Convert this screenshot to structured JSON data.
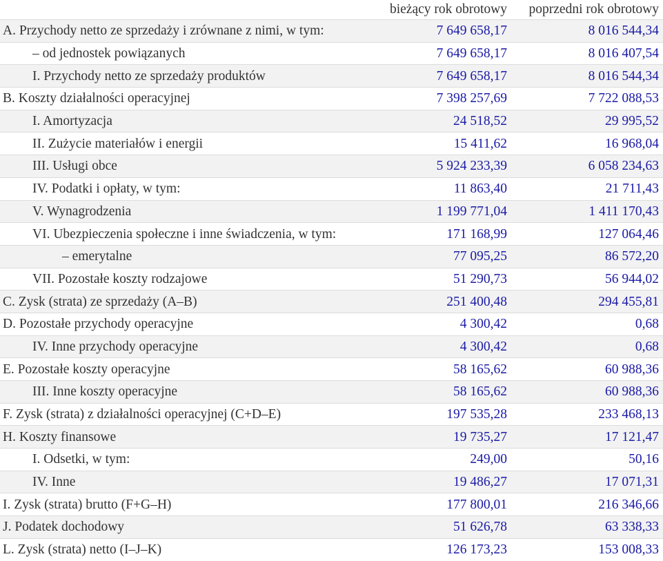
{
  "header": {
    "label": "",
    "current": "bieżący rok obrotowy",
    "previous": "poprzedni rok obrotowy"
  },
  "rows": [
    {
      "label": "A. Przychody netto ze sprzedaży i zrównane z nimi, w tym:",
      "current": "7 649 658,17",
      "previous": "8 016 544,34",
      "indent": 0
    },
    {
      "label": "– od jednostek powiązanych",
      "current": "7 649 658,17",
      "previous": "8 016 407,54",
      "indent": 1
    },
    {
      "label": "I. Przychody netto ze sprzedaży produktów",
      "current": "7 649 658,17",
      "previous": "8 016 544,34",
      "indent": 1
    },
    {
      "label": "B. Koszty działalności operacyjnej",
      "current": "7 398 257,69",
      "previous": "7 722 088,53",
      "indent": 0
    },
    {
      "label": "I. Amortyzacja",
      "current": "24 518,52",
      "previous": "29 995,52",
      "indent": 1
    },
    {
      "label": "II. Zużycie materiałów i energii",
      "current": "15 411,62",
      "previous": "16 968,04",
      "indent": 1
    },
    {
      "label": "III. Usługi obce",
      "current": "5 924 233,39",
      "previous": "6 058 234,63",
      "indent": 1
    },
    {
      "label": "IV. Podatki i opłaty, w tym:",
      "current": "11 863,40",
      "previous": "21 711,43",
      "indent": 1
    },
    {
      "label": "V. Wynagrodzenia",
      "current": "1 199 771,04",
      "previous": "1 411 170,43",
      "indent": 1
    },
    {
      "label": "VI. Ubezpieczenia społeczne i inne świadczenia, w tym:",
      "current": "171 168,99",
      "previous": "127 064,46",
      "indent": 1
    },
    {
      "label": "– emerytalne",
      "current": "77 095,25",
      "previous": "86 572,20",
      "indent": 2
    },
    {
      "label": "VII. Pozostałe koszty rodzajowe",
      "current": "51 290,73",
      "previous": "56 944,02",
      "indent": 1
    },
    {
      "label": "C. Zysk (strata) ze sprzedaży (A–B)",
      "current": "251 400,48",
      "previous": "294 455,81",
      "indent": 0
    },
    {
      "label": "D. Pozostałe przychody operacyjne",
      "current": "4 300,42",
      "previous": "0,68",
      "indent": 0
    },
    {
      "label": "IV. Inne przychody operacyjne",
      "current": "4 300,42",
      "previous": "0,68",
      "indent": 1
    },
    {
      "label": "E. Pozostałe koszty operacyjne",
      "current": "58 165,62",
      "previous": "60 988,36",
      "indent": 0
    },
    {
      "label": "III. Inne koszty operacyjne",
      "current": "58 165,62",
      "previous": "60 988,36",
      "indent": 1
    },
    {
      "label": "F. Zysk (strata) z działalności operacyjnej (C+D–E)",
      "current": "197 535,28",
      "previous": "233 468,13",
      "indent": 0
    },
    {
      "label": "H. Koszty finansowe",
      "current": "19 735,27",
      "previous": "17 121,47",
      "indent": 0
    },
    {
      "label": "I. Odsetki, w tym:",
      "current": "249,00",
      "previous": "50,16",
      "indent": 1
    },
    {
      "label": "IV. Inne",
      "current": "19 486,27",
      "previous": "17 071,31",
      "indent": 1
    },
    {
      "label": "I. Zysk (strata) brutto (F+G–H)",
      "current": "177 800,01",
      "previous": "216 346,66",
      "indent": 0
    },
    {
      "label": "J. Podatek dochodowy",
      "current": "51 626,78",
      "previous": "63 338,33",
      "indent": 0
    },
    {
      "label": "L. Zysk (strata) netto (I–J–K)",
      "current": "126 173,23",
      "previous": "153 008,33",
      "indent": 0
    }
  ]
}
